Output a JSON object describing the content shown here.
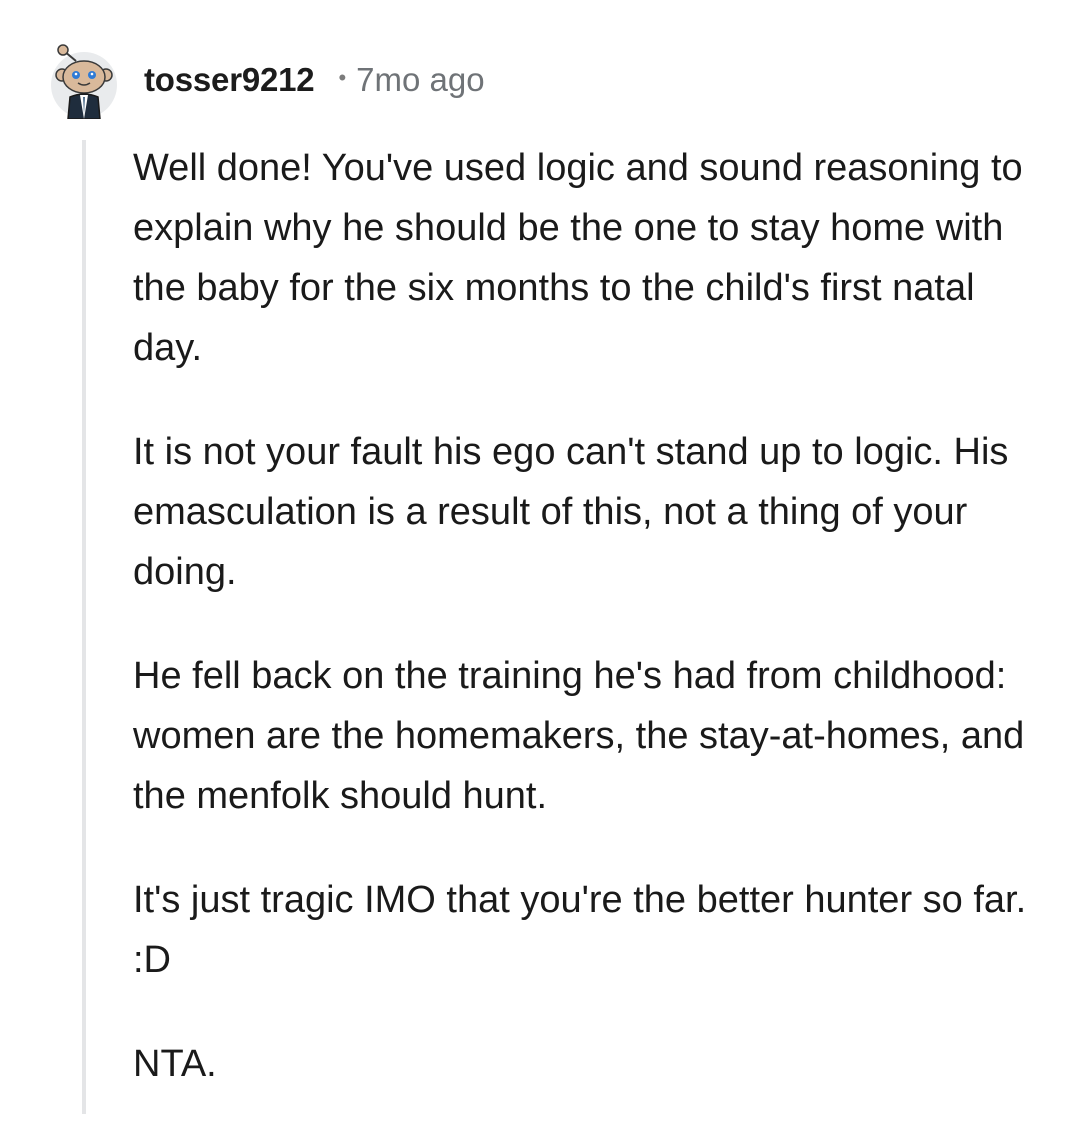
{
  "comment": {
    "username": "tosser9212",
    "separator": "•",
    "timestamp": "7mo ago",
    "paragraphs": [
      "Well done! You've used logic and sound reasoning to explain why he should be the one to stay home with the baby for the six months to the child's first natal day.",
      "It is not your fault his ego can't stand up to logic. His emasculation is a result of this, not a thing of your doing.",
      "He fell back on the training he's had from childhood: women are the homemakers, the stay-at-homes, and the menfolk should hunt.",
      "It's just tragic IMO that you're the better hunter so far. :D",
      "NTA."
    ]
  },
  "colors": {
    "username": "#1c1c1c",
    "timestamp": "#6f7377",
    "thread_line": "#e4e5e7",
    "text": "#1a1a1a"
  },
  "icons": {
    "avatar": "snoo-avatar-icon"
  }
}
